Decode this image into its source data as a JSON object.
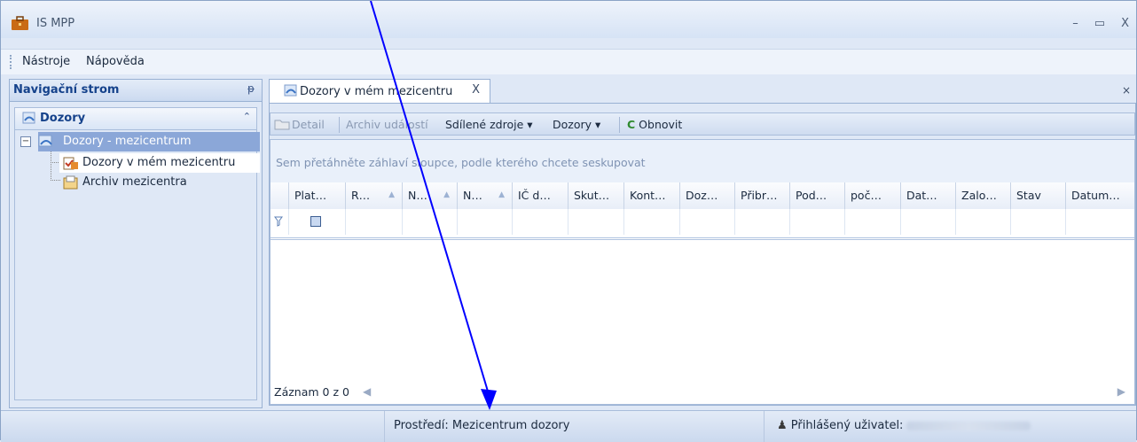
{
  "window": {
    "title": "IS MPP",
    "min": "–",
    "max": "▭",
    "close": "X"
  },
  "menu": {
    "items": [
      "Nástroje",
      "Nápověda"
    ]
  },
  "nav": {
    "title": "Navigační strom",
    "pin": "ᵽ",
    "group": "Dozory",
    "tree": {
      "expander": "−",
      "root": "Dozory - mezicentrum",
      "children": [
        "Dozory v mém mezicentru",
        "Archiv mezicentra"
      ]
    }
  },
  "tab": {
    "label": "Dozory v mém mezicentru",
    "close": "X",
    "panel_close": "×"
  },
  "toolbar": {
    "detail": "Detail",
    "archive": "Archiv událostí",
    "shared": "Sdílené zdroje",
    "dozory": "Dozory",
    "refresh": "Obnovit",
    "dropdown": "▾"
  },
  "grid": {
    "groupby_hint": "Sem přetáhněte záhlaví sloupce, podle kterého chcete seskupovat",
    "columns": [
      "Plat…",
      "R…",
      "N…",
      "N…",
      "IČ d…",
      "Skut…",
      "Kont…",
      "Doz…",
      "Přibr…",
      "Pod…",
      "poč…",
      "Dat…",
      "Zalo…",
      "Stav",
      "Datum…"
    ],
    "footer": "Záznam 0 z 0"
  },
  "status": {
    "env_label": "Prostředí: Mezicentrum dozory",
    "user_label": "Přihlášený uživatel:"
  },
  "colors": {
    "accent": "#15428b",
    "selection": "#8ba7d8",
    "annotation": "#0000ff"
  }
}
